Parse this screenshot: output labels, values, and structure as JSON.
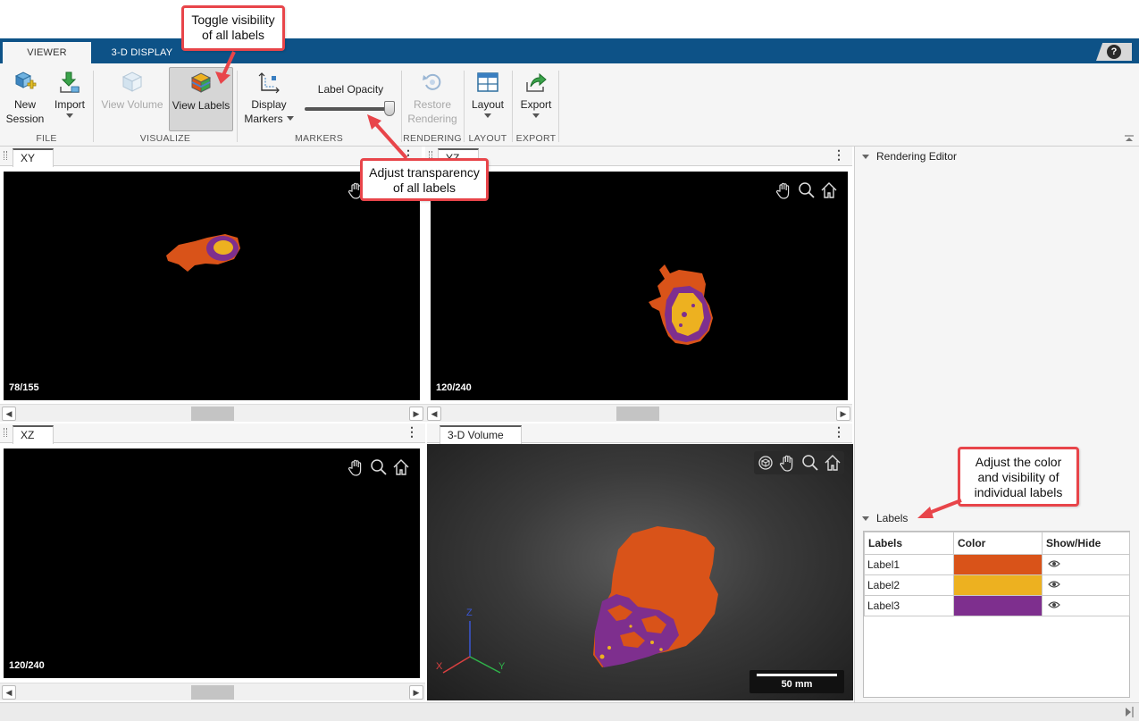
{
  "tabs": [
    {
      "label": "VIEWER",
      "active": true
    },
    {
      "label": "3-D DISPLAY",
      "active": false
    }
  ],
  "help_label": "?",
  "toolstrip": {
    "new_session": "New\nSession",
    "new_session_l1": "New",
    "new_session_l2": "Session",
    "import": "Import",
    "view_volume": "View Volume",
    "view_labels": "View Labels",
    "display_markers_l1": "Display",
    "display_markers_l2": "Markers",
    "label_opacity": "Label Opacity",
    "label_opacity_value": 1.0,
    "restore_l1": "Restore",
    "restore_l2": "Rendering",
    "layout": "Layout",
    "export": "Export",
    "groups": {
      "file": "FILE",
      "visualize": "VISUALIZE",
      "markers": "MARKERS",
      "rendering": "RENDERING",
      "layout": "LAYOUT",
      "export": "EXPORT"
    }
  },
  "panes": {
    "xy": {
      "tab": "XY",
      "slice": "78/155"
    },
    "yz": {
      "tab": "YZ",
      "slice": "120/240"
    },
    "xz": {
      "tab": "XZ",
      "slice": "120/240"
    },
    "volume": {
      "tab": "3-D Volume",
      "scale": "50 mm",
      "axes": {
        "x": "X",
        "y": "Y",
        "z": "Z"
      }
    }
  },
  "right_panel": {
    "rendering_editor": "Rendering Editor",
    "labels_section": "Labels",
    "table": {
      "headers": [
        "Labels",
        "Color",
        "Show/Hide"
      ],
      "rows": [
        {
          "name": "Label1",
          "color": "#d95319"
        },
        {
          "name": "Label2",
          "color": "#edb120"
        },
        {
          "name": "Label3",
          "color": "#7e2f8e"
        }
      ]
    }
  },
  "callouts": {
    "toggle": "Toggle visibility of all labels",
    "toggle_l1": "Toggle visibility",
    "toggle_l2": "of all labels",
    "opacity_l1": "Adjust transparency",
    "opacity_l2": "of all labels",
    "labels_l1": "Adjust the color",
    "labels_l2": "and visibility of",
    "labels_l3": "individual labels"
  },
  "colors": {
    "tabbar": "#0d5287",
    "label1": "#d95319",
    "label2": "#edb120",
    "label3": "#7e2f8e",
    "callout_border": "#e8454a"
  }
}
